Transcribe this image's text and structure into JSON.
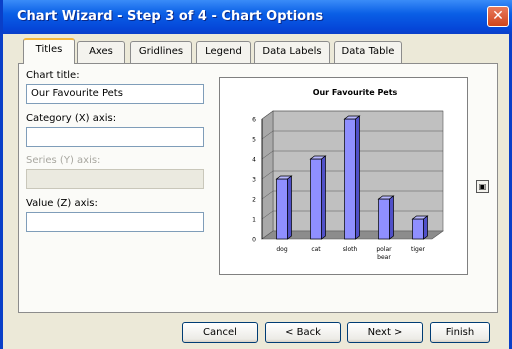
{
  "window": {
    "title": "Chart Wizard - Step 3 of 4 - Chart Options",
    "close_glyph": "✕"
  },
  "tabs": [
    {
      "label": "Titles",
      "active": true
    },
    {
      "label": "Axes"
    },
    {
      "label": "Gridlines"
    },
    {
      "label": "Legend"
    },
    {
      "label": "Data Labels"
    },
    {
      "label": "Data Table"
    }
  ],
  "form": {
    "chart_title_label": "Chart title:",
    "chart_title_value": "Our Favourite Pets",
    "category_axis_label": "Category (X) axis:",
    "category_axis_value": "",
    "series_axis_label": "Series (Y) axis:",
    "series_axis_value": "",
    "value_axis_label": "Value (Z) axis:",
    "value_axis_value": ""
  },
  "side_button_icon": "collapse-preview-icon",
  "buttons": {
    "cancel": "Cancel",
    "back": "< Back",
    "next": "Next >",
    "finish": "Finish"
  },
  "colors": {
    "bar_fill": "#8f8fff",
    "wall": "#c0c0c0",
    "title_bar": "#0a5fe6"
  },
  "chart_data": {
    "type": "bar",
    "title": "Our Favourite Pets",
    "categories": [
      "dog",
      "cat",
      "sloth",
      "polar bear",
      "tiger"
    ],
    "values": [
      3,
      4,
      6,
      2,
      1
    ],
    "ylim": [
      0,
      6
    ],
    "yticks": [
      0,
      1,
      2,
      3,
      4,
      5,
      6
    ],
    "style": "3d-column",
    "gridlines": true,
    "legend": "none"
  }
}
